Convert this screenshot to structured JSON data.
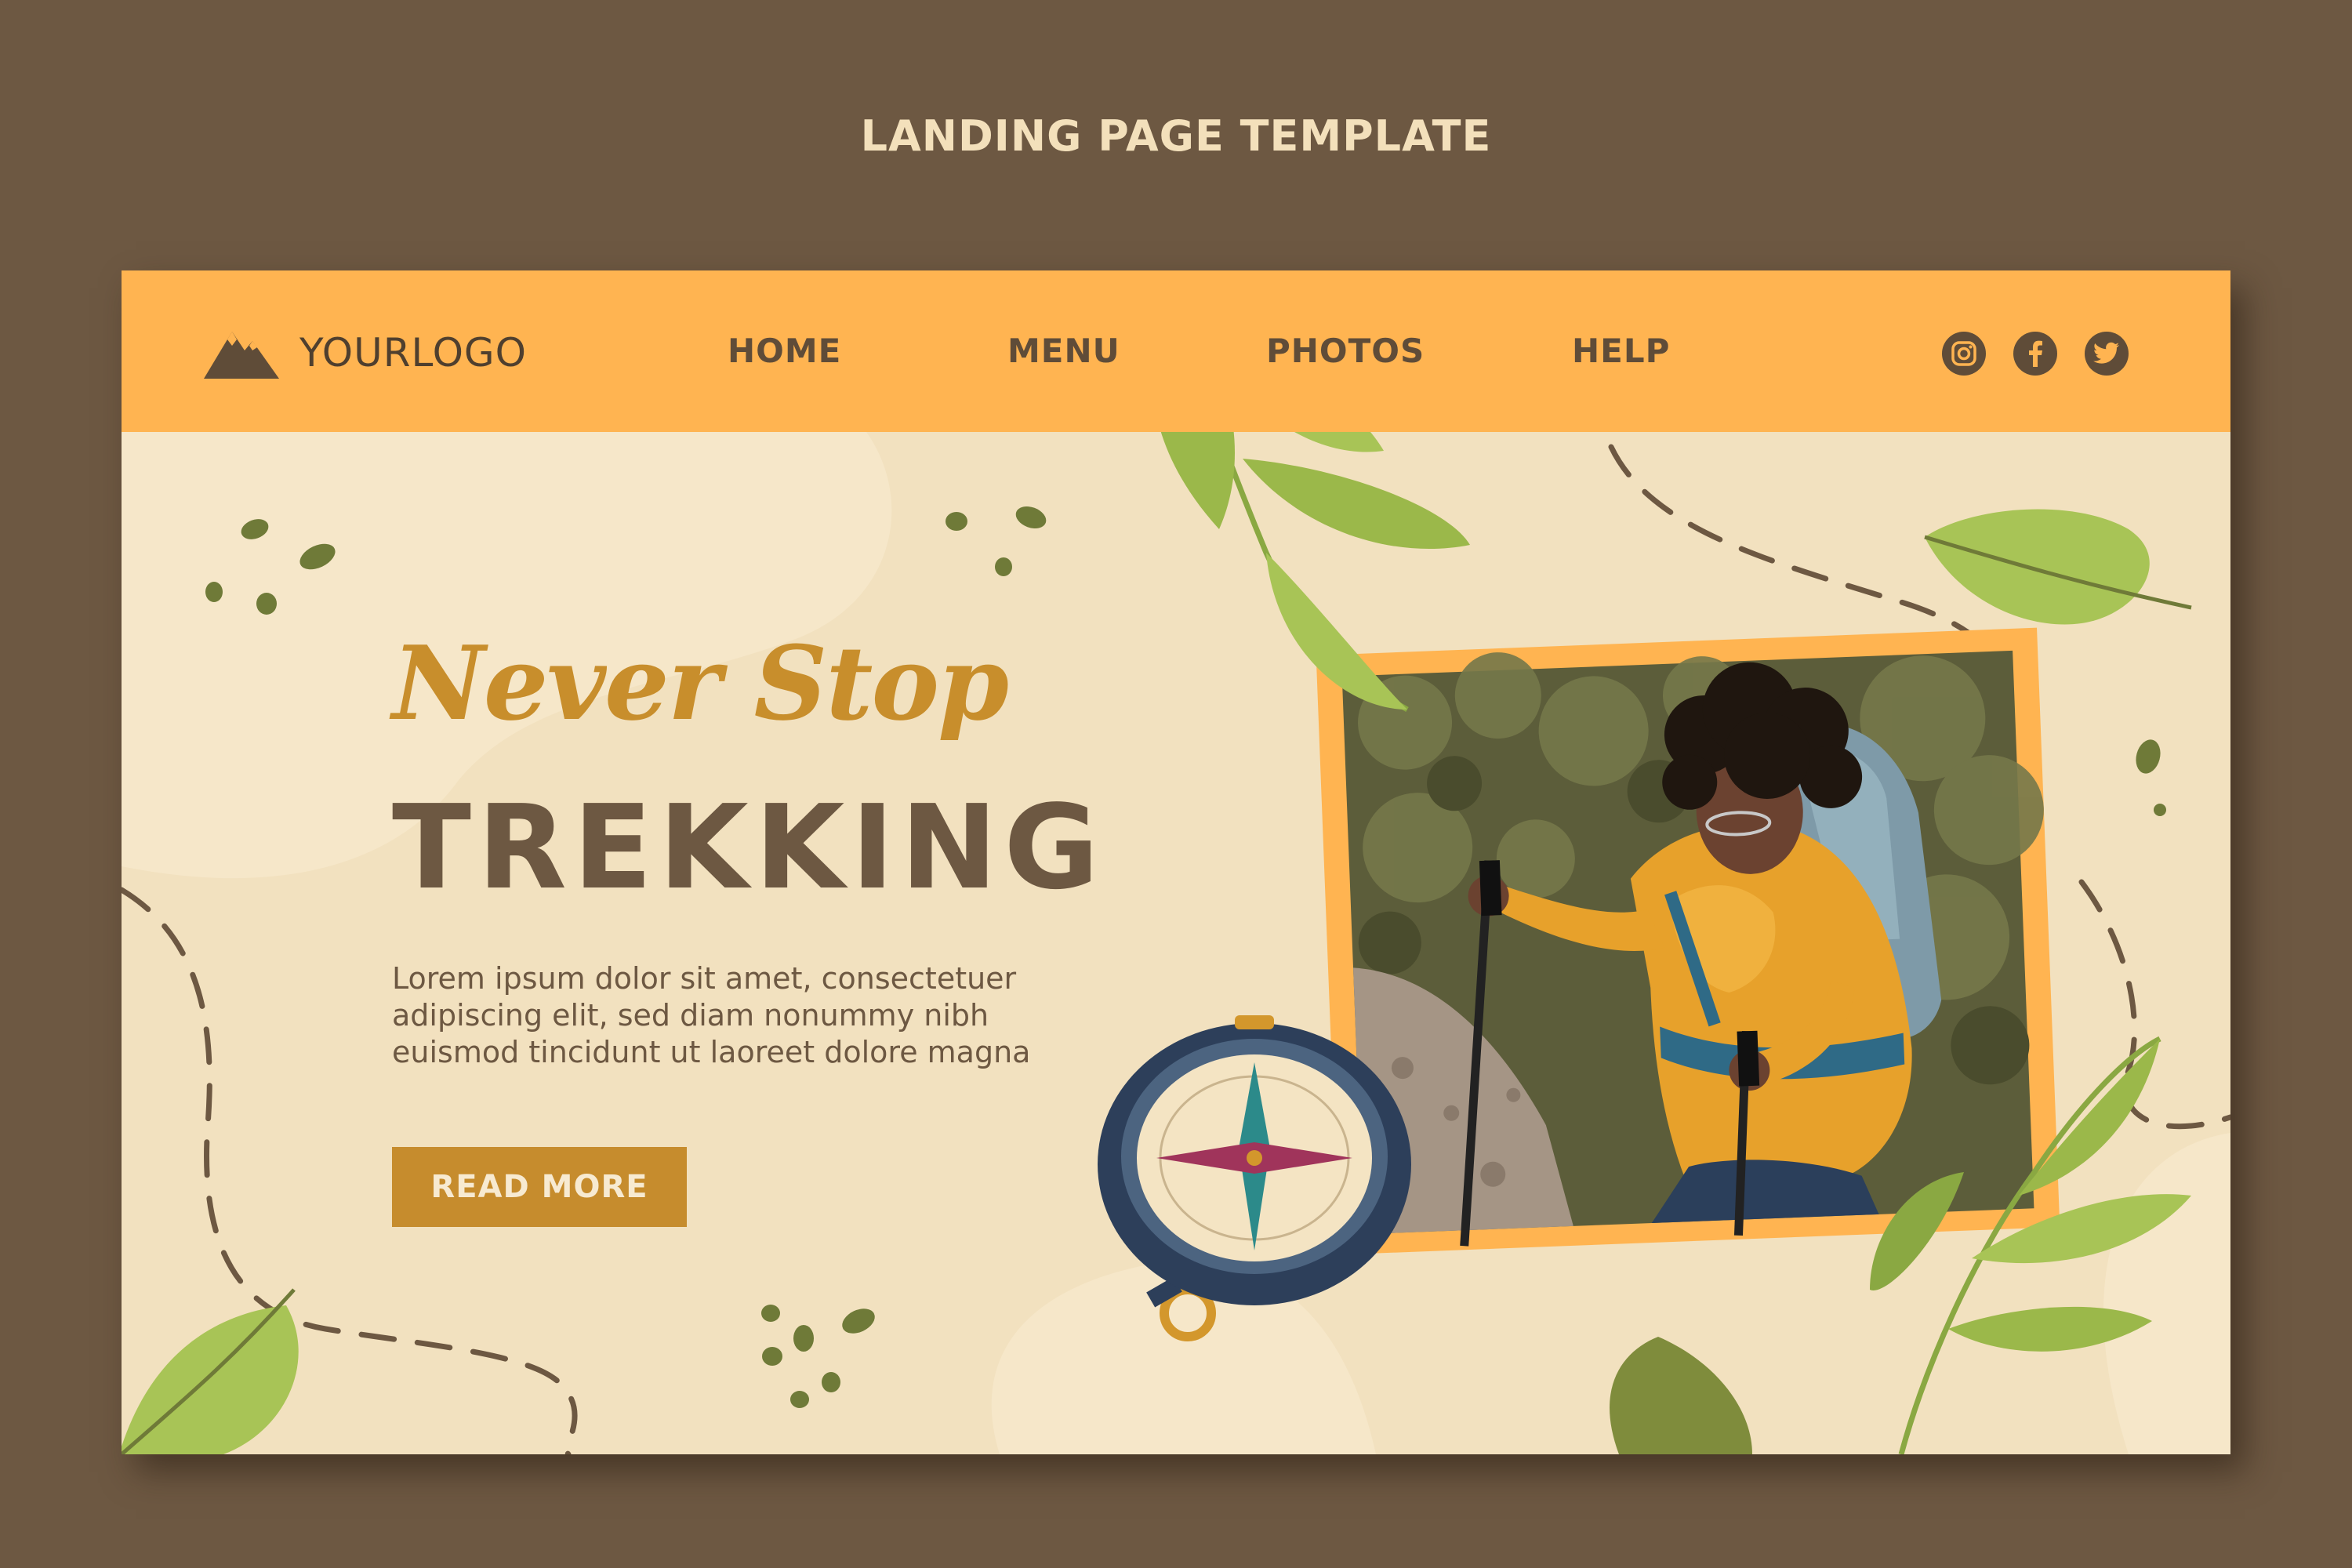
{
  "caption": "LANDING PAGE TEMPLATE",
  "colors": {
    "background": "#6d5842",
    "card": "#f2e1bf",
    "navbar": "#ffb451",
    "accent": "#c68c2d",
    "text_dark": "#6d5842",
    "leaf": "#9bb84a"
  },
  "header": {
    "logo_text": "YOURLOGO",
    "logo_icon": "mountain-icon",
    "nav": [
      "HOME",
      "MENU",
      "PHOTOS",
      "HELP"
    ],
    "social": [
      "instagram-icon",
      "facebook-icon",
      "twitter-icon"
    ]
  },
  "hero": {
    "tagline": "Never Stop",
    "headline": "TREKKING",
    "body": "Lorem ipsum dolor sit amet, consectetuer adipiscing elit, sed diam nonummy nibh euismod tincidunt ut laoreet dolore magna",
    "cta": "READ MORE"
  }
}
